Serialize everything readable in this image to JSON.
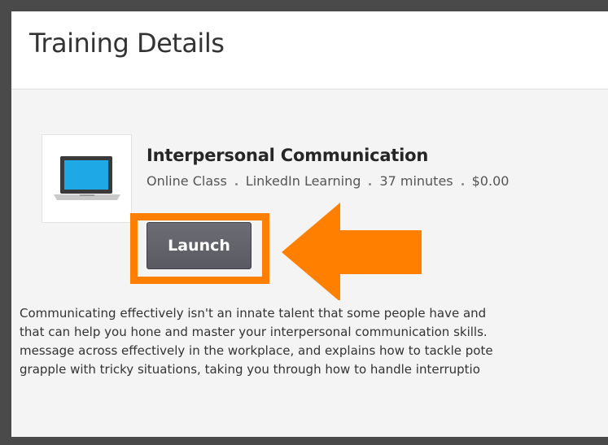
{
  "page": {
    "title": "Training Details"
  },
  "course": {
    "title": "Interpersonal Communication",
    "meta": [
      "Online Class",
      "LinkedIn Learning",
      "37 minutes",
      "$0.00"
    ],
    "thumbnail_icon": "laptop-icon",
    "launch_label": "Launch",
    "description_lines": [
      "Communicating effectively isn't an innate talent that some people have and",
      "that can help you hone and master your interpersonal communication skills.",
      "message across effectively in the workplace, and explains how to tackle pote",
      "grapple with tricky situations, taking you through how to handle interruptio"
    ]
  },
  "annotations": {
    "highlight_color": "#ff8000",
    "arrow_icon": "arrow-left-icon"
  },
  "colors": {
    "frame": "#4a4a4a",
    "background": "#f4f4f4",
    "button": "#606068",
    "laptop_screen": "#1fa8e6"
  }
}
